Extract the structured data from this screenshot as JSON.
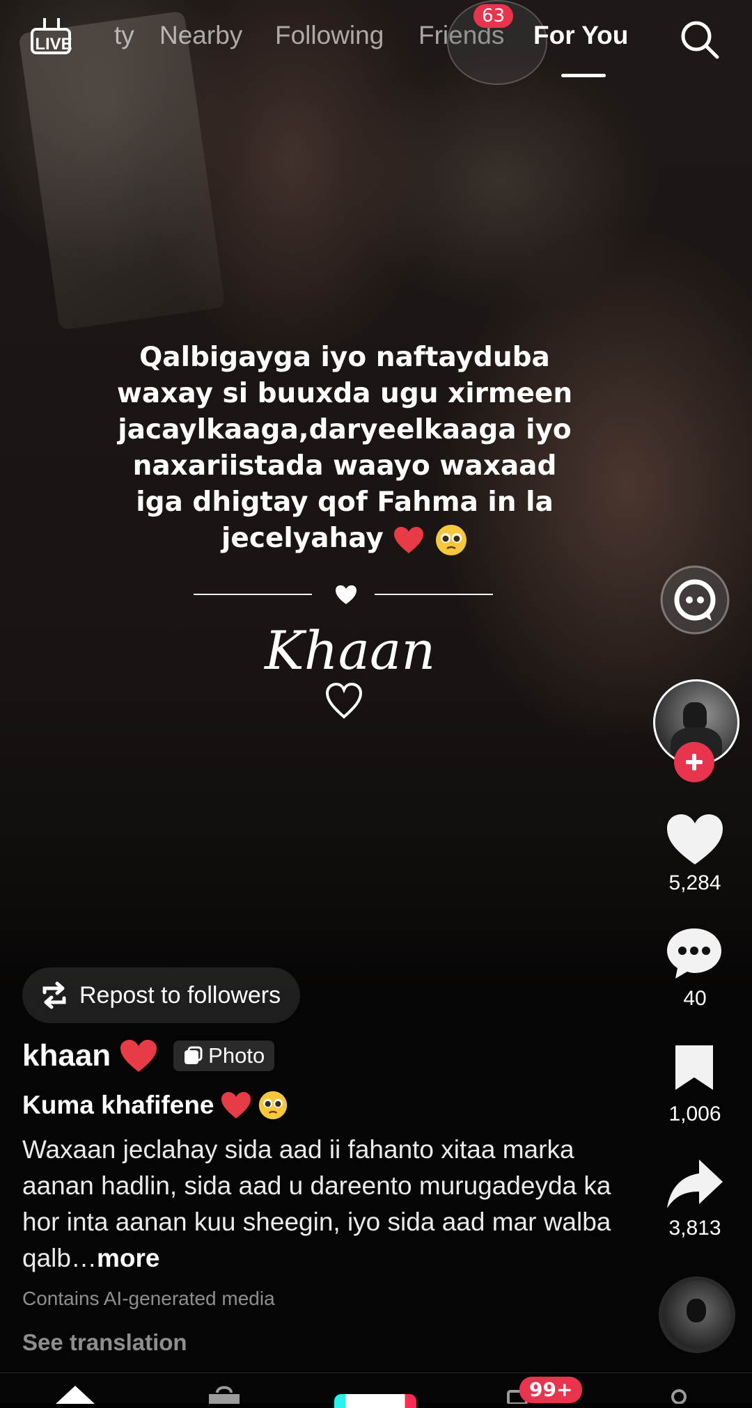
{
  "top_nav": {
    "live_label": "LIVE",
    "tabs": [
      {
        "label": "ty",
        "active": false
      },
      {
        "label": "Nearby",
        "active": false
      },
      {
        "label": "Following",
        "active": false
      },
      {
        "label": "Friends",
        "active": false
      },
      {
        "label": "For You",
        "active": true
      }
    ],
    "friends_badge": "63"
  },
  "caption": {
    "lines": [
      "Qalbigayga iyo naftayduba",
      "waxay si buuxda ugu xirmeen",
      "jacaylkaaga,daryeelkaaga iyo",
      "naxariistada waayo waxaad",
      "iga dhigtay qof Fahma in la",
      "jecelyahay"
    ],
    "signature": "Khaan"
  },
  "actions": {
    "likes": "5,284",
    "comments": "40",
    "saves": "1,006",
    "shares": "3,813"
  },
  "repost_label": "Repost to followers",
  "author": {
    "username": "khaan",
    "chip": "Photo"
  },
  "post": {
    "title": "Kuma khafifene",
    "description": "Waxaan jeclahay sida aad ii fahanto xitaa marka aanan hadlin, sida aad u dareento murugadeyda ka hor inta aanan kuu sheegin, iyo sida aad mar walba qalb…",
    "more": "more",
    "ai_notice": "Contains AI-generated media",
    "see_translation": "See translation"
  },
  "bottom_nav": {
    "inbox_badge": "99+"
  },
  "colors": {
    "accent_red": "#e8354d",
    "heart_red": "#e83b45"
  }
}
